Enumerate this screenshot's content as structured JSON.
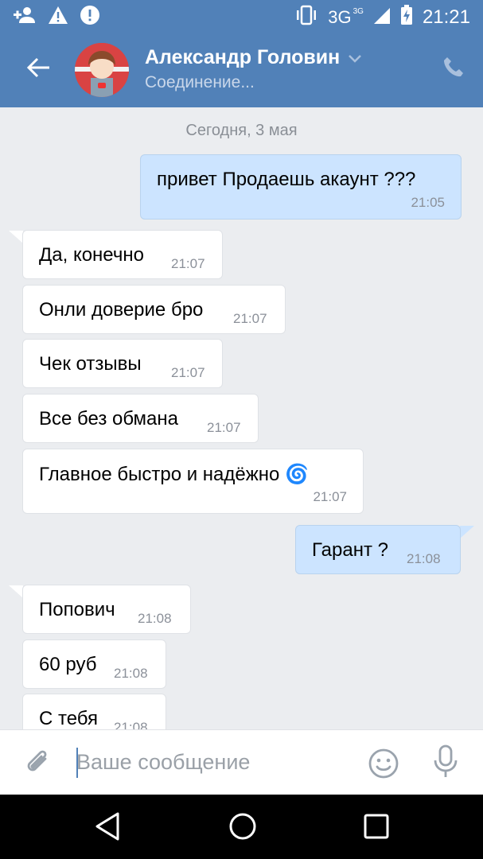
{
  "status_bar": {
    "network": "3G",
    "network_sup": "3G",
    "time": "21:21",
    "icons": [
      "add-contact-icon",
      "warning-icon",
      "alert-icon",
      "vibrate-icon",
      "signal-icon",
      "battery-charging-icon"
    ]
  },
  "header": {
    "contact_name": "Александр Головин",
    "status": "Соединение...",
    "back_icon": "arrow-left-icon",
    "call_icon": "phone-icon"
  },
  "chat": {
    "date_separator": "Сегодня, 3 мая",
    "messages": [
      {
        "dir": "out",
        "text": "привет Продаешь акаунт ???",
        "time": "21:05"
      },
      {
        "dir": "in",
        "text": "Да, конечно",
        "time": "21:07"
      },
      {
        "dir": "in",
        "text": "Онли доверие бро",
        "time": "21:07"
      },
      {
        "dir": "in",
        "text": "Чек отзывы",
        "time": "21:07"
      },
      {
        "dir": "in",
        "text": "Все без обмана",
        "time": "21:07"
      },
      {
        "dir": "in",
        "text": "Главное быстро и надёжно 🌀",
        "time": "21:07"
      },
      {
        "dir": "out",
        "text": "Гарант ?",
        "time": "21:08"
      },
      {
        "dir": "in",
        "text": "Попович",
        "time": "21:08"
      },
      {
        "dir": "in",
        "text": "60 руб",
        "time": "21:08"
      },
      {
        "dir": "in",
        "text": "С тебя",
        "time": "21:08"
      }
    ]
  },
  "composer": {
    "placeholder": "Ваше сообщение",
    "value": ""
  },
  "colors": {
    "header_bg": "#5181b8",
    "chat_bg": "#ebedf0",
    "out_bubble": "#cce4ff",
    "in_bubble": "#ffffff"
  }
}
